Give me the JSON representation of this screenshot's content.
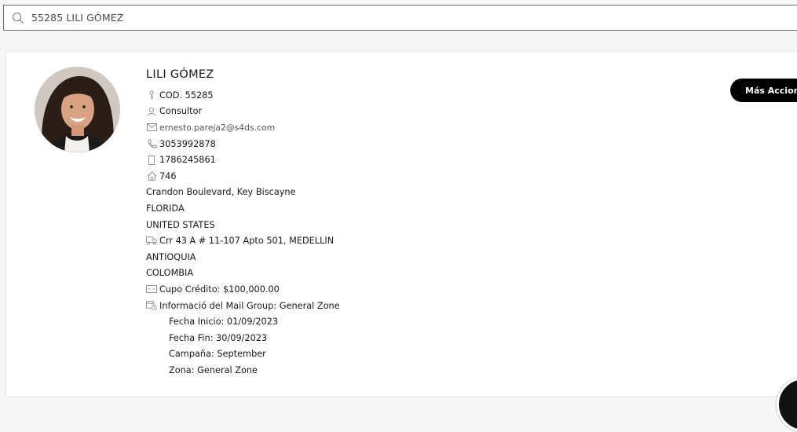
{
  "search": {
    "value": "55285 LILI GÓMEZ"
  },
  "profile": {
    "name": "LILI GÓMEZ",
    "code": "COD. 55285",
    "role": "Consultor",
    "email": "ernesto.pareja2@s4ds.com",
    "phone": "3053992878",
    "mobile": "1786245861",
    "address_number": "746",
    "address_lines": [
      "Crandon Boulevard, Key Biscayne",
      "FLORIDA",
      "UNITED STATES"
    ],
    "shipping_address": "Crr 43 A # 11-107 Apto 501, MEDELLIN",
    "shipping_lines": [
      "ANTIOQUIA",
      "COLOMBIA"
    ],
    "credit": "Cupo Crédito: $100,000.00",
    "mail_group": {
      "title": "Informació del Mail Group: General Zone",
      "start": "Fecha Inicio: 01/09/2023",
      "end": "Fecha Fin: 30/09/2023",
      "campaign": "Campaña: September",
      "zone": "Zona: General Zone"
    }
  },
  "actions": {
    "more_label": "Más Acciones"
  },
  "icons": {
    "search": "search-icon",
    "code": "key-icon",
    "role": "user-icon",
    "email": "mail-icon",
    "phone": "phone-icon",
    "mobile": "mobile-icon",
    "home": "home-icon",
    "shipping": "truck-icon",
    "credit": "credit-card-icon",
    "calendar": "calendar-clock-icon"
  },
  "colors": {
    "button_bg": "#000000",
    "button_text": "#ffffff",
    "icon": "#8a8a8a"
  }
}
